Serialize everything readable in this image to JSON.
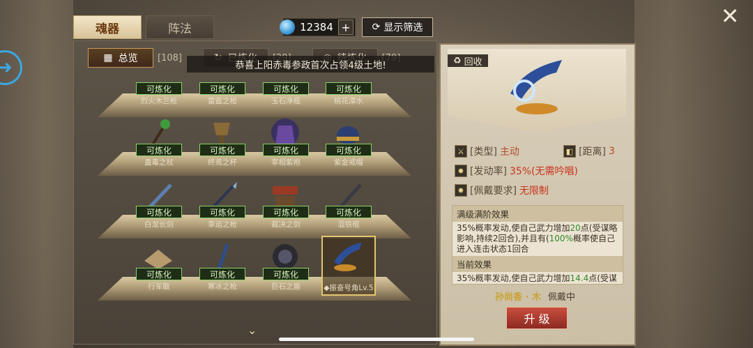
{
  "top_tabs": [
    {
      "label": "魂器",
      "active": true
    },
    {
      "label": "阵法",
      "active": false
    }
  ],
  "currency": {
    "value": "12384",
    "plus": "+"
  },
  "filter_button": "显示筛选",
  "close": "✕",
  "subtabs": [
    {
      "label": "总览",
      "count": "[108]",
      "active": true
    },
    {
      "label": "已炼化",
      "count": "[29]",
      "active": false
    },
    {
      "label": "待炼化",
      "count": "[79]",
      "active": false
    }
  ],
  "toast": "恭喜上阳赤毒参政首次占领4级土地!",
  "items": [
    {
      "name": "烈火木兰枪",
      "badge": "可炼化"
    },
    {
      "name": "雷霆之枪",
      "badge": "可炼化"
    },
    {
      "name": "玉石净瓶",
      "badge": "可炼化"
    },
    {
      "name": "桃花潭水",
      "badge": "可炼化"
    },
    {
      "name": "蛊毒之杖",
      "badge": "可炼化"
    },
    {
      "name": "终焉之杯",
      "badge": "可炼化"
    },
    {
      "name": "宰相紫袍",
      "badge": "可炼化"
    },
    {
      "name": "紫金戒帽",
      "badge": "可炼化"
    },
    {
      "name": "白龙长剑",
      "badge": "可炼化"
    },
    {
      "name": "幸运之枪",
      "badge": "可炼化"
    },
    {
      "name": "裁决之剑",
      "badge": "可炼化"
    },
    {
      "name": "混铁棍",
      "badge": "可炼化"
    },
    {
      "name": "行军散",
      "badge": "可炼化"
    },
    {
      "name": "寒冰之枪",
      "badge": "可炼化"
    },
    {
      "name": "巨石之盾",
      "badge": "可炼化"
    },
    {
      "name": "◆振奋号角Lv.5",
      "badge": ""
    }
  ],
  "detail": {
    "recycle": "回收",
    "type_key": "[类型]",
    "type_val": "主动",
    "range_key": "[距离]",
    "range_val": "3",
    "trigger_key": "[发动率]",
    "trigger_val": "35%(无需吟唱)",
    "req_key": "[佩戴要求]",
    "req_val": "无限制",
    "max_title": "满级满阶效果",
    "max_text_1": "35%概率发动,使自己武力增加",
    "max_num_1": "20",
    "max_text_2": "点(受谋略影响,持续2回合),并且有(",
    "max_num_2": "100%",
    "max_text_3": "概率使自己进入连击状态1回合",
    "cur_title": "当前效果",
    "cur_text_1": "35%概率发动,使自己武力增加",
    "cur_num_1": "14.4",
    "cur_text_2": "点(受谋",
    "wearer_name": "孙尚香 · 木",
    "wearer_status": "佩戴中",
    "upgrade": "升 级"
  }
}
